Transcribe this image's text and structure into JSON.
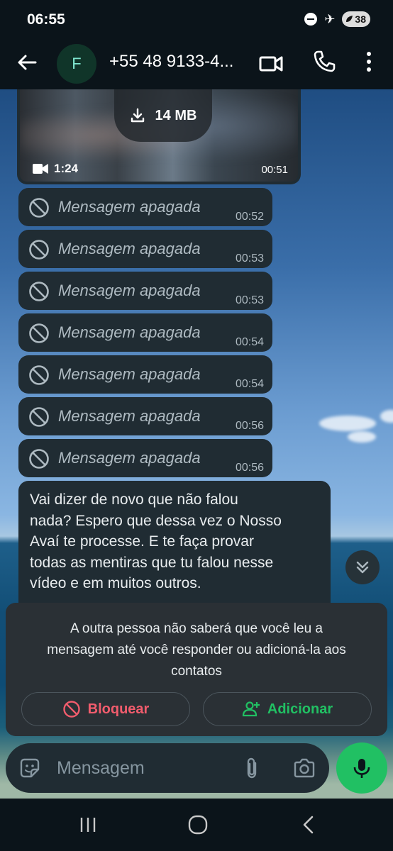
{
  "status_bar": {
    "time": "06:55",
    "battery": "38",
    "icons": [
      "do-not-disturb-icon",
      "airplane-icon",
      "battery-saver-icon"
    ]
  },
  "header": {
    "avatar_letter": "F",
    "contact_name": "+55 48 9133-4..."
  },
  "video_message": {
    "size_label": "14 MB",
    "duration": "1:24",
    "time": "00:51"
  },
  "deleted_messages": [
    {
      "text": "Mensagem apagada",
      "time": "00:52"
    },
    {
      "text": "Mensagem apagada",
      "time": "00:53"
    },
    {
      "text": "Mensagem apagada",
      "time": "00:53"
    },
    {
      "text": "Mensagem apagada",
      "time": "00:54"
    },
    {
      "text": "Mensagem apagada",
      "time": "00:54"
    },
    {
      "text": "Mensagem apagada",
      "time": "00:56"
    },
    {
      "text": "Mensagem apagada",
      "time": "00:56"
    }
  ],
  "text_message": {
    "lines": [
      "Vai dizer de novo que não falou",
      "nada? Espero que dessa vez o Nosso",
      "Avaí te processe. E te faça provar",
      "todas as mentiras que tu falou nesse",
      "vídeo e em muitos outros."
    ]
  },
  "notice": {
    "lines": [
      "A outra pessoa não saberá que você leu a",
      "mensagem até você responder ou adicioná-la aos",
      "contatos"
    ],
    "block_label": "Bloquear",
    "add_label": "Adicionar"
  },
  "composer": {
    "placeholder": "Mensagem"
  },
  "colors": {
    "accent_green": "#21c063",
    "block_red": "#f15c6d",
    "bubble": "#202c33",
    "header": "#0b141a"
  }
}
